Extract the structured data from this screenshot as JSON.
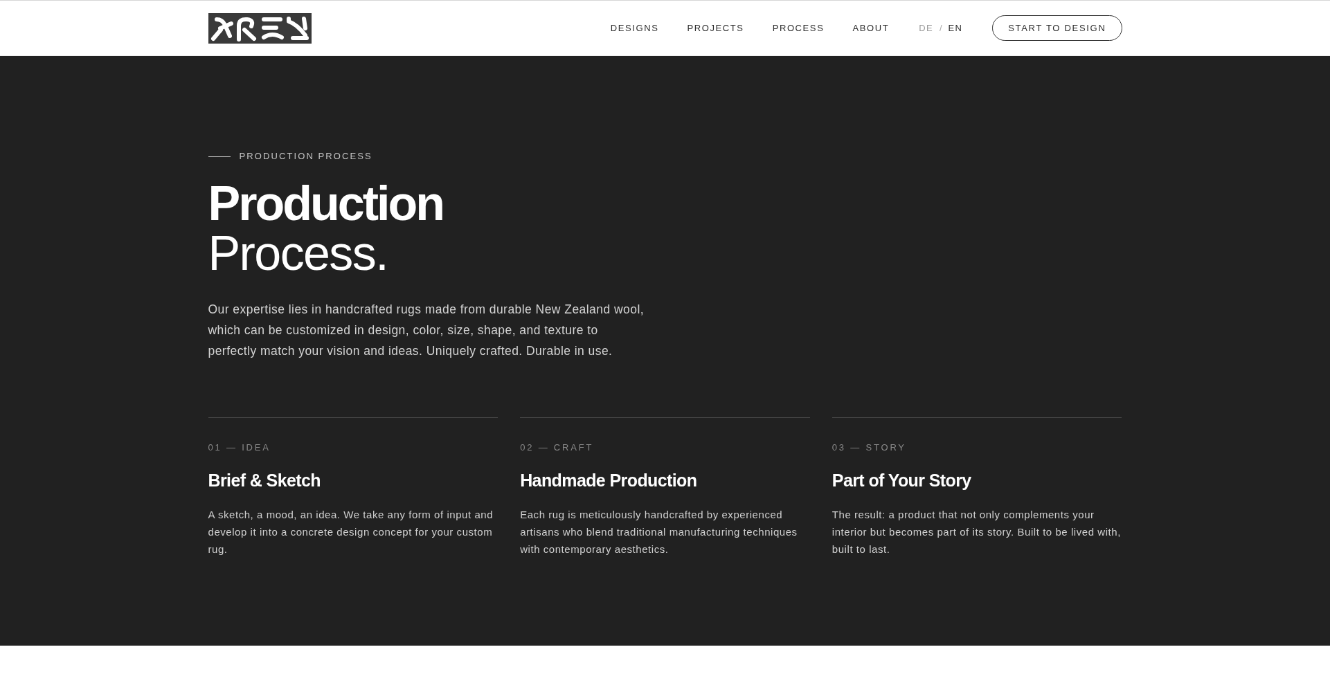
{
  "header": {
    "nav": [
      {
        "label": "DESIGNS"
      },
      {
        "label": "PROJECTS"
      },
      {
        "label": "PROCESS"
      },
      {
        "label": "ABOUT"
      }
    ],
    "languages": [
      {
        "label": "DE",
        "selected": false
      },
      {
        "label": "EN",
        "selected": true
      }
    ],
    "language_separator": "/",
    "cta": "START TO DESIGN"
  },
  "hero": {
    "eyebrow": "PRODUCTION PROCESS",
    "heading": {
      "line_1": "Production",
      "line_2": "Process."
    },
    "intro": "Our expertise lies in handcrafted rugs made from durable New Zealand wool, which can be customized in design, color, size, shape, and texture to perfectly match your vision and ideas. Uniquely crafted. Durable in use."
  },
  "steps": [
    {
      "label": "01 — IDEA",
      "title": "Brief & Sketch",
      "text": "A sketch, a mood, an idea. We take any form of input and develop it into a concrete design concept for your custom rug."
    },
    {
      "label": "02 — CRAFT",
      "title": "Handmade Production",
      "text": "Each rug is meticulously handcrafted by experienced artisans who blend traditional manufacturing techniques with contemporary aesthetics."
    },
    {
      "label": "03 — STORY",
      "title": "Part of Your Story",
      "text": "The result: a product that not only complements your interior but becomes part of its story. Built to be lived with, built to last."
    }
  ]
}
